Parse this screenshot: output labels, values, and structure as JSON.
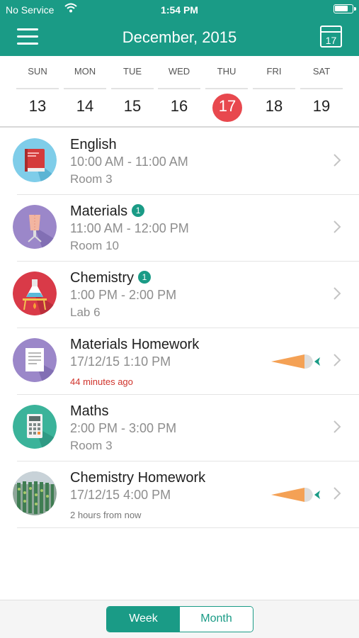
{
  "status_bar": {
    "carrier": "No Service",
    "time": "1:54 PM"
  },
  "header": {
    "title": "December, 2015",
    "calendar_button_day": "17"
  },
  "week": {
    "days": [
      {
        "name": "SUN",
        "date": "13"
      },
      {
        "name": "MON",
        "date": "14"
      },
      {
        "name": "TUE",
        "date": "15"
      },
      {
        "name": "WED",
        "date": "16"
      },
      {
        "name": "THU",
        "date": "17",
        "selected": true
      },
      {
        "name": "FRI",
        "date": "18"
      },
      {
        "name": "SAT",
        "date": "19"
      }
    ]
  },
  "schedule": [
    {
      "title": "English",
      "time": "10:00 AM - 11:00 AM",
      "location": "Room 3",
      "icon": "book-icon"
    },
    {
      "title": "Materials",
      "badge": "1",
      "time": "11:00 AM - 12:00 PM",
      "location": "Room 10",
      "icon": "mannequin-icon"
    },
    {
      "title": "Chemistry",
      "badge": "1",
      "time": "1:00 PM - 2:00 PM",
      "location": "Lab 6",
      "icon": "flask-icon"
    },
    {
      "title": "Materials Homework",
      "time": "17/12/15 1:10 PM",
      "note": "44 minutes ago",
      "note_color": "#d0332b",
      "icon": "document-icon",
      "has_carrot": true
    },
    {
      "title": "Maths",
      "time": "2:00 PM - 3:00 PM",
      "location": "Room 3",
      "icon": "calculator-icon"
    },
    {
      "title": "Chemistry Homework",
      "time": "17/12/15 4:00 PM",
      "note": "2 hours from now",
      "icon": "photo-thumbnail-icon",
      "has_carrot": true
    }
  ],
  "view_toggle": {
    "week_label": "Week",
    "month_label": "Month",
    "selected": "Week"
  },
  "colors": {
    "brand": "#1a9b86",
    "today": "#e8484e",
    "overdue": "#d0332b"
  }
}
